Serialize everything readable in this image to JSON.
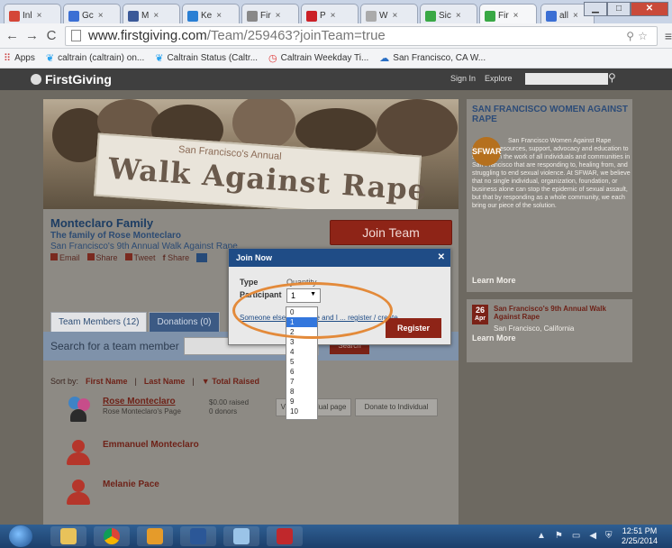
{
  "browser": {
    "tabs": [
      {
        "label": "Inl",
        "color": "#d44638"
      },
      {
        "label": "Gc",
        "color": "#3b6fd4"
      },
      {
        "label": "M",
        "color": "#3b5998"
      },
      {
        "label": "Ke",
        "color": "#2a7fd4"
      },
      {
        "label": "Fir",
        "color": "#888888"
      },
      {
        "label": "P",
        "color": "#cb2027"
      },
      {
        "label": "W",
        "color": "#aaaaaa"
      },
      {
        "label": "Sic",
        "color": "#39a845"
      },
      {
        "label": "Fir",
        "color": "#39a845"
      },
      {
        "label": "all",
        "color": "#3b6fd4"
      }
    ],
    "url_domain": "www.firstgiving.com",
    "url_path": "/Team/259463?joinTeam=true",
    "bookmarks": [
      {
        "label": "Apps",
        "icon": "apps-grid-icon"
      },
      {
        "label": "caltrain (caltrain) on...",
        "icon": "twitter-bird-icon"
      },
      {
        "label": "Caltrain Status (Caltr...",
        "icon": "twitter-bird-icon"
      },
      {
        "label": "Caltrain Weekday Ti...",
        "icon": "clock-icon"
      },
      {
        "label": "San Francisco, CA W...",
        "icon": "weather-icon"
      }
    ]
  },
  "site": {
    "logo": "FirstGiving",
    "signin": "Sign In",
    "explore": "Explore"
  },
  "banner": {
    "small": "San Francisco's Annual",
    "big": "Walk Against Rape"
  },
  "team": {
    "name": "Monteclaro Family",
    "sub1": "The family of Rose Monteclaro",
    "sub2": "San Francisco's 9th Annual Walk Against Rape",
    "share": [
      "Email",
      "Share",
      "Tweet",
      "Share"
    ],
    "join_label": "Join Team"
  },
  "members_tab": {
    "tab_members": "Team Members (12)",
    "tab_donations": "Donations (0)",
    "search_label": "Search for a team member",
    "search_button": "Search",
    "sort_by": "Sort by:",
    "sort_first": "First Name",
    "sort_last": "Last Name",
    "sort_total": "Total Raised",
    "members": [
      {
        "name": "Rose Monteclaro",
        "sub": "Rose Monteclaro's Page",
        "raised": "$0.00 raised",
        "donors": "0 donors"
      },
      {
        "name": "Emmanuel Monteclaro"
      },
      {
        "name": "Melanie Pace"
      }
    ],
    "view_button": "View individual page",
    "donate_button": "Donate to Individual"
  },
  "sidebar": {
    "title": "SAN FRANCISCO WOMEN AGAINST RAPE",
    "logo_text": "SFWAR",
    "description": "San Francisco Women Against Rape provides resources, support, advocacy and education to strengthen the work of all individuals and communities in San Francisco that are responding to, healing from, and struggling to end sexual violence. At SFWAR, we believe that no single individual, organization, foundation, or business alone can stop the epidemic of sexual assault, but that by responding as a whole community, we each bring our piece of the solution.",
    "learn_more": "Learn More",
    "event_day": "26",
    "event_month": "Apr",
    "event_title": "San Francisco's 9th Annual Walk Against Rape",
    "event_location": "San Francisco, California",
    "event_more": "Learn More"
  },
  "modal": {
    "title": "Join Now",
    "type_label": "Type",
    "qty_label": "Quantity",
    "participant_label": "Participant",
    "selected_qty": "1",
    "link_text": "Someone else ... and me and I ... register / create",
    "register": "Register",
    "options": [
      "0",
      "1",
      "2",
      "3",
      "4",
      "5",
      "6",
      "7",
      "8",
      "9",
      "10"
    ]
  },
  "taskbar": {
    "time": "12:51 PM",
    "date": "2/25/2014"
  }
}
